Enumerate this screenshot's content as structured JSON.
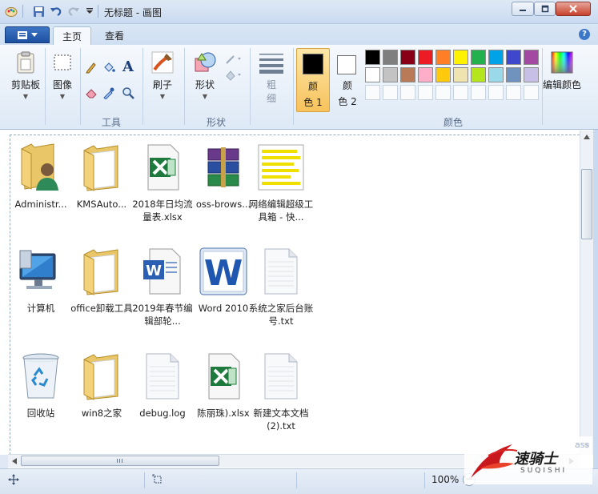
{
  "window": {
    "title": "无标题 - 画图"
  },
  "tabs": [
    {
      "label": "主页",
      "active": true
    },
    {
      "label": "查看",
      "active": false
    }
  ],
  "ribbon": {
    "clipboard": {
      "label": "剪贴板"
    },
    "image": {
      "label": "图像"
    },
    "tools": {
      "group_label": "工具"
    },
    "brushes": {
      "label": "刷子"
    },
    "shapes": {
      "label": "形状",
      "group_label": "形状"
    },
    "size": {
      "label_line1": "粗",
      "label_line2": "细"
    },
    "color1": {
      "label_line1": "颜",
      "label_line2": "色 1",
      "value": "#000000"
    },
    "color2": {
      "label_line1": "颜",
      "label_line2": "色 2",
      "value": "#ffffff"
    },
    "colors_group_label": "颜色",
    "edit_colors": {
      "label": "编辑颜色"
    },
    "palette_row1": [
      "#000000",
      "#7f7f7f",
      "#880015",
      "#ed1c24",
      "#ff7f27",
      "#fff200",
      "#22b14c",
      "#00a2e8",
      "#3f48cc",
      "#a349a4"
    ],
    "palette_row2": [
      "#ffffff",
      "#c3c3c3",
      "#b97a57",
      "#ffaec9",
      "#ffc90e",
      "#efe4b0",
      "#b5e61d",
      "#99d9ea",
      "#7092be",
      "#c8bfe7"
    ]
  },
  "files": [
    {
      "name": "Administr...",
      "icon": "user-folder-icon"
    },
    {
      "name": "KMSAuto...",
      "icon": "folder-icon"
    },
    {
      "name": "2018年日均流量表.xlsx",
      "icon": "excel-icon"
    },
    {
      "name": "oss-brows...",
      "icon": "winrar-icon"
    },
    {
      "name": "网络编辑超级工具箱 - 快...",
      "icon": "text-doc-yellow-icon"
    },
    {
      "name": "计算机",
      "icon": "computer-icon"
    },
    {
      "name": "office卸载工具",
      "icon": "folder-icon"
    },
    {
      "name": "2019年春节编辑部轮...",
      "icon": "word-doc-icon"
    },
    {
      "name": "Word 2010",
      "icon": "word-app-icon"
    },
    {
      "name": "系统之家后台账号.txt",
      "icon": "text-file-icon"
    },
    {
      "name": "回收站",
      "icon": "recycle-bin-icon"
    },
    {
      "name": "win8之家",
      "icon": "folder-icon"
    },
    {
      "name": "debug.log",
      "icon": "text-file-icon"
    },
    {
      "name": "陈丽珠).xlsx",
      "icon": "excel-icon"
    },
    {
      "name": "新建文本文档 (2).txt",
      "icon": "text-file-icon"
    }
  ],
  "status": {
    "zoom": "100%"
  },
  "watermark": {
    "text": "速骑士",
    "sub": "SUQISHI",
    "tail": "ass"
  }
}
